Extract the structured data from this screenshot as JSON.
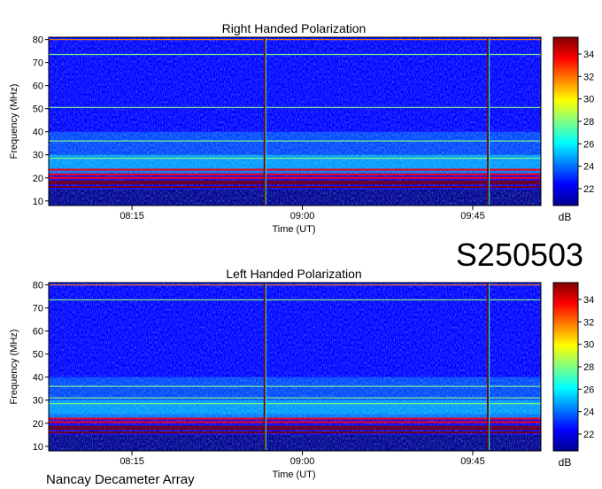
{
  "observation_id": "S250503",
  "footer": "Nancay Decameter Array",
  "colors": {
    "colormap": [
      "#00008f",
      "#0000ff",
      "#0080ff",
      "#00ffff",
      "#80ff80",
      "#ffff00",
      "#ff8000",
      "#ff0000",
      "#800000"
    ]
  },
  "chart_data": [
    {
      "type": "heatmap",
      "title": "Right Handed Polarization",
      "xlabel": "Time (UT)",
      "ylabel": "Frequency (MHz)",
      "x_ticks": [
        "08:15",
        "09:00",
        "09:45"
      ],
      "y_ticks": [
        10,
        20,
        30,
        40,
        50,
        60,
        70,
        80
      ],
      "ylim": [
        8,
        81
      ],
      "colorbar": {
        "label": "dB",
        "ticks": [
          22,
          24,
          26,
          28,
          30,
          32,
          34
        ],
        "range": [
          20.5,
          35.5
        ]
      },
      "persistent_bands_mhz": [
        80,
        73.5,
        50.5,
        36,
        28.5,
        23.5,
        21.5,
        20,
        18.5,
        17.5,
        16
      ],
      "broadband_bursts_time": [
        "08:50",
        "09:49"
      ]
    },
    {
      "type": "heatmap",
      "title": "Left Handed Polarization",
      "xlabel": "Time (UT)",
      "ylabel": "Frequency (MHz)",
      "x_ticks": [
        "08:15",
        "09:00",
        "09:45"
      ],
      "y_ticks": [
        10,
        20,
        30,
        40,
        50,
        60,
        70,
        80
      ],
      "ylim": [
        8,
        81
      ],
      "colorbar": {
        "label": "dB",
        "ticks": [
          22,
          24,
          26,
          28,
          30,
          32,
          34
        ],
        "range": [
          20.5,
          35.5
        ]
      },
      "persistent_bands_mhz": [
        80,
        73.5,
        36,
        31,
        28.5,
        22,
        20.5,
        18.5,
        17.5,
        16
      ],
      "broadband_bursts_time": [
        "08:50",
        "09:49"
      ]
    }
  ]
}
